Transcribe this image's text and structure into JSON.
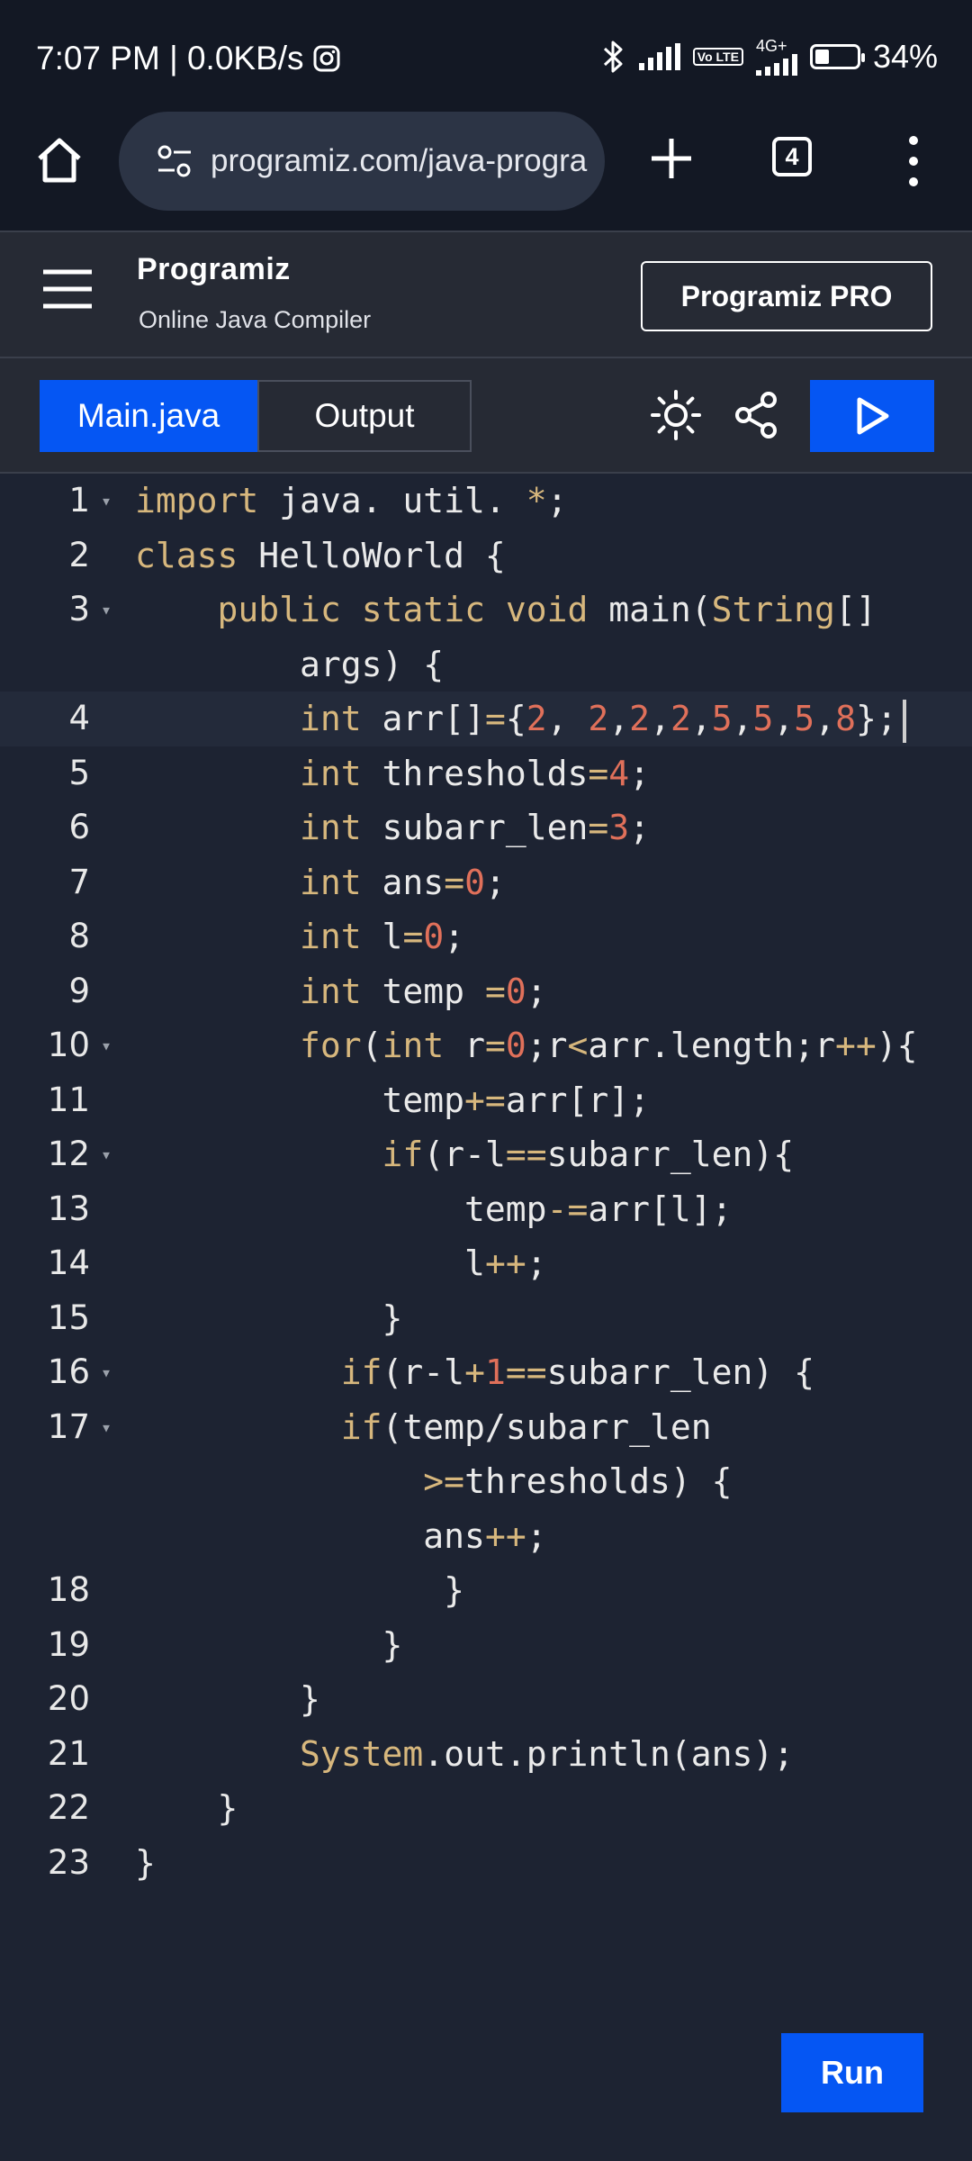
{
  "status": {
    "time_speed": "7:07 PM | 0.0KB/s",
    "volte": "Vo LTE",
    "network": "4G+",
    "battery": "34%",
    "battery_level": 0.34
  },
  "browser": {
    "url": "programiz.com/java-progra",
    "tab_count": "4"
  },
  "header": {
    "logo": "Programiz",
    "subtitle": "Online Java Compiler",
    "pro_button": "Programiz PRO"
  },
  "toolbar": {
    "tab_main": "Main.java",
    "tab_output": "Output"
  },
  "editor": {
    "lines": [
      {
        "n": "1"
      },
      {
        "n": "2"
      },
      {
        "n": "3"
      },
      {
        "n": ""
      },
      {
        "n": "4"
      },
      {
        "n": "5"
      },
      {
        "n": "6"
      },
      {
        "n": "7"
      },
      {
        "n": "8"
      },
      {
        "n": "9"
      },
      {
        "n": "10"
      },
      {
        "n": "11"
      },
      {
        "n": "12"
      },
      {
        "n": "13"
      },
      {
        "n": "14"
      },
      {
        "n": "15"
      },
      {
        "n": "16"
      },
      {
        "n": "17"
      },
      {
        "n": ""
      },
      {
        "n": ""
      },
      {
        "n": "18"
      },
      {
        "n": "19"
      },
      {
        "n": "20"
      },
      {
        "n": "21"
      },
      {
        "n": "22"
      },
      {
        "n": "23"
      }
    ],
    "code": [
      "import java. util. *;",
      "class HelloWorld {",
      "    public static void main(String[]",
      "        args) {",
      "        int arr[]={2, 2,2,2,5,5,5,8};",
      "        int thresholds=4;",
      "        int subarr_len=3;",
      "        int ans=0;",
      "        int l=0;",
      "        int temp =0;",
      "        for(int r=0;r<arr.length;r++){",
      "            temp+=arr[r];",
      "            if(r-l==subarr_len){",
      "                temp-=arr[l];",
      "                l++;",
      "            }",
      "          if(r-l+1==subarr_len) {",
      "          if(temp/subarr_len",
      "              >=thresholds) {",
      "              ans++;",
      "               }",
      "            }",
      "        }",
      "        System.out.println(ans);",
      "    }",
      "}"
    ]
  },
  "run_button": "Run"
}
